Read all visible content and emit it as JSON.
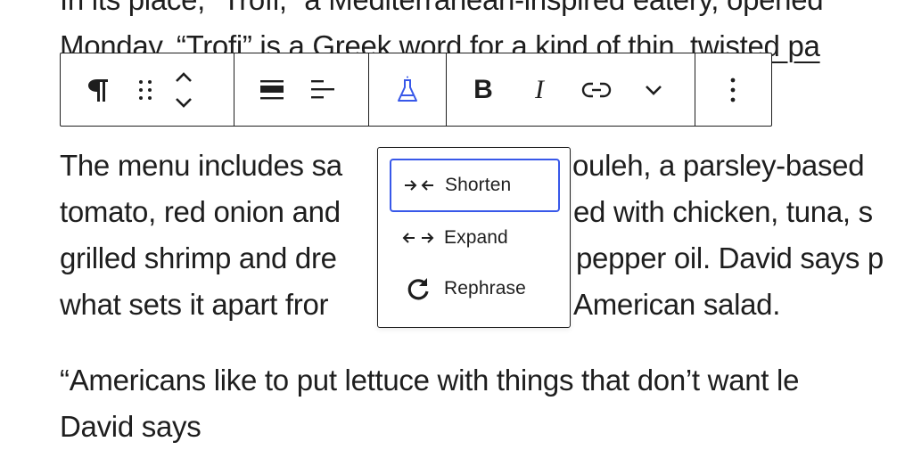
{
  "content": {
    "top_line_1": "In its place, “Trofi,” a Mediterranean-inspired eatery, opened",
    "top_line_2": "Monday. “Trofi” is a Greek word for a kind of thin, twisted pa",
    "mid_lines": [
      "The menu includes sa",
      "ouleh, a parsley-based",
      "tomato, red onion and",
      "ed with chicken, tuna, s",
      "grilled shrimp and dre",
      "pepper oil. David says p",
      "what sets it apart fror",
      "American salad."
    ],
    "bottom_line_1": "“Americans like to put lettuce with things that don’t want le",
    "bottom_line_2": "David says"
  },
  "toolbar": {
    "paragraph_icon": "paragraph-icon",
    "drag_icon": "drag-handle-icon",
    "move_icon": "move-up-down-icon",
    "align_icon": "align-wide-icon",
    "text_align_icon": "text-align-left-icon",
    "ai_icon": "flask-icon",
    "bold_label": "B",
    "italic_label": "I",
    "link_icon": "link-icon",
    "more_icon": "chevron-down-icon",
    "options_icon": "more-vertical-icon",
    "accent_color": "#3858e9"
  },
  "popover": {
    "items": [
      {
        "label": "Shorten",
        "icon": "shorten-arrows-icon",
        "focused": true
      },
      {
        "label": "Expand",
        "icon": "expand-arrows-icon",
        "focused": false
      },
      {
        "label": "Rephrase",
        "icon": "rotate-icon",
        "focused": false
      }
    ]
  }
}
